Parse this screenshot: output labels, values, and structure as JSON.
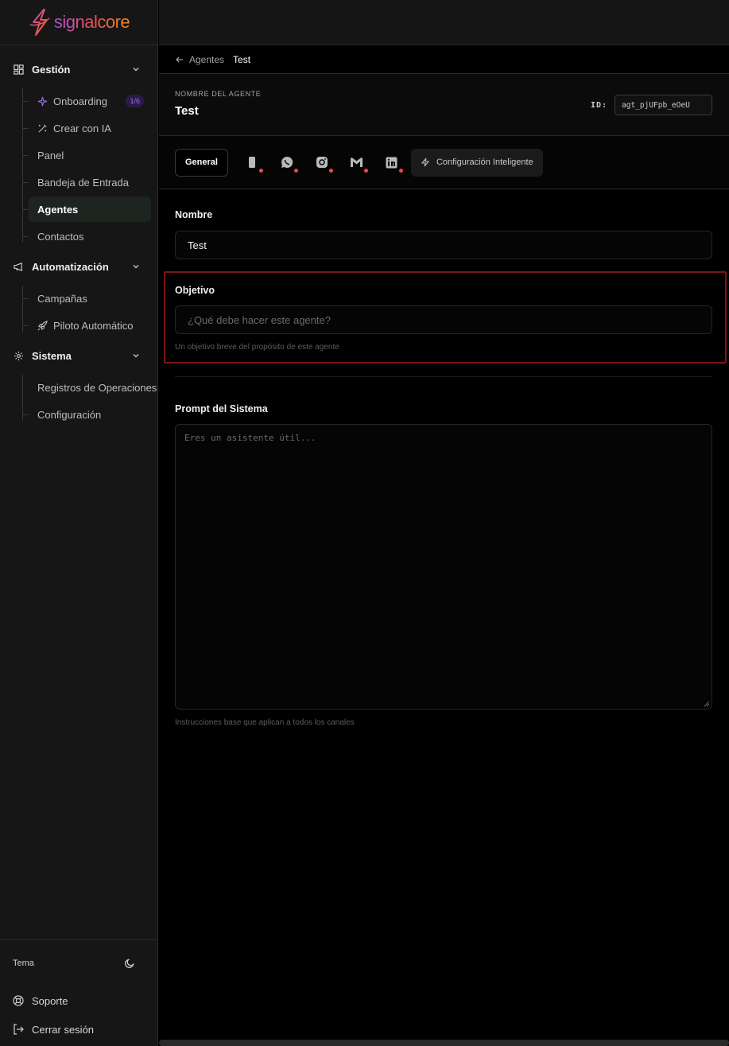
{
  "brand": {
    "logo_text": "signalcore",
    "colors": {
      "gradient_start": "#b14bdc",
      "gradient_mid": "#e5554f",
      "gradient_end": "#f08a2b"
    }
  },
  "sidebar": {
    "groups": [
      {
        "label": "Gestión",
        "icon": "grid-icon",
        "items": [
          {
            "label": "Onboarding",
            "icon": "sparkles-icon",
            "badge": "1/6"
          },
          {
            "label": "Crear con IA",
            "icon": "magic-wand-icon"
          },
          {
            "label": "Panel"
          },
          {
            "label": "Bandeja de Entrada"
          },
          {
            "label": "Agentes",
            "active": true
          },
          {
            "label": "Contactos"
          }
        ]
      },
      {
        "label": "Automatización",
        "icon": "megaphone-icon",
        "items": [
          {
            "label": "Campañas"
          },
          {
            "label": "Piloto Automático",
            "icon": "rocket-icon"
          }
        ]
      },
      {
        "label": "Sistema",
        "icon": "gear-icon",
        "items": [
          {
            "label": "Registros de Operaciones"
          },
          {
            "label": "Configuración"
          }
        ]
      }
    ],
    "bottom": {
      "theme_label": "Tema",
      "support_label": "Soporte",
      "logout_label": "Cerrar sesión"
    }
  },
  "breadcrumb": {
    "parent": "Agentes",
    "current": "Test"
  },
  "agent": {
    "name_label": "NOMBRE DEL AGENTE",
    "name": "Test",
    "id_label": "ID:",
    "id_value": "agt_pjUFpb_eOeU"
  },
  "tabs": {
    "general": "General",
    "channels": [
      "phone-icon",
      "whatsapp-icon",
      "instagram-icon",
      "gmail-icon",
      "linkedin-icon"
    ],
    "smart": "Configuración Inteligente",
    "status_dot_color": "#e5484d"
  },
  "form": {
    "nombre_label": "Nombre",
    "nombre_value": "Test",
    "objetivo_label": "Objetivo",
    "objetivo_placeholder": "¿Qué debe hacer este agente?",
    "objetivo_help": "Un objetivo breve del propósito de este agente",
    "prompt_label": "Prompt del Sistema",
    "prompt_placeholder": "Eres un asistente útil...",
    "prompt_help": "Instrucciones base que aplican a todos los canales"
  }
}
